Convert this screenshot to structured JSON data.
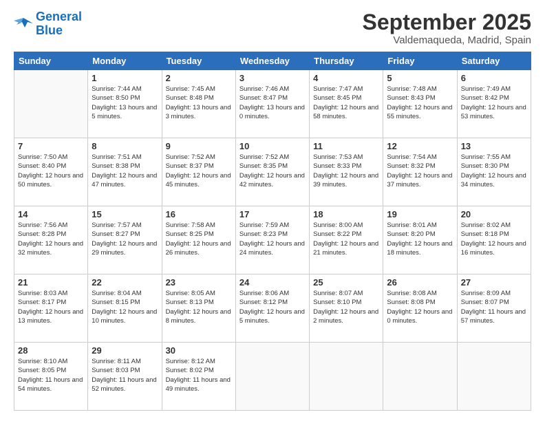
{
  "logo": {
    "line1": "General",
    "line2": "Blue"
  },
  "title": "September 2025",
  "location": "Valdemaqueda, Madrid, Spain",
  "weekdays": [
    "Sunday",
    "Monday",
    "Tuesday",
    "Wednesday",
    "Thursday",
    "Friday",
    "Saturday"
  ],
  "weeks": [
    [
      null,
      {
        "day": 1,
        "sunrise": "7:44 AM",
        "sunset": "8:50 PM",
        "daylight": "13 hours and 5 minutes."
      },
      {
        "day": 2,
        "sunrise": "7:45 AM",
        "sunset": "8:48 PM",
        "daylight": "13 hours and 3 minutes."
      },
      {
        "day": 3,
        "sunrise": "7:46 AM",
        "sunset": "8:47 PM",
        "daylight": "13 hours and 0 minutes."
      },
      {
        "day": 4,
        "sunrise": "7:47 AM",
        "sunset": "8:45 PM",
        "daylight": "12 hours and 58 minutes."
      },
      {
        "day": 5,
        "sunrise": "7:48 AM",
        "sunset": "8:43 PM",
        "daylight": "12 hours and 55 minutes."
      },
      {
        "day": 6,
        "sunrise": "7:49 AM",
        "sunset": "8:42 PM",
        "daylight": "12 hours and 53 minutes."
      }
    ],
    [
      {
        "day": 7,
        "sunrise": "7:50 AM",
        "sunset": "8:40 PM",
        "daylight": "12 hours and 50 minutes."
      },
      {
        "day": 8,
        "sunrise": "7:51 AM",
        "sunset": "8:38 PM",
        "daylight": "12 hours and 47 minutes."
      },
      {
        "day": 9,
        "sunrise": "7:52 AM",
        "sunset": "8:37 PM",
        "daylight": "12 hours and 45 minutes."
      },
      {
        "day": 10,
        "sunrise": "7:52 AM",
        "sunset": "8:35 PM",
        "daylight": "12 hours and 42 minutes."
      },
      {
        "day": 11,
        "sunrise": "7:53 AM",
        "sunset": "8:33 PM",
        "daylight": "12 hours and 39 minutes."
      },
      {
        "day": 12,
        "sunrise": "7:54 AM",
        "sunset": "8:32 PM",
        "daylight": "12 hours and 37 minutes."
      },
      {
        "day": 13,
        "sunrise": "7:55 AM",
        "sunset": "8:30 PM",
        "daylight": "12 hours and 34 minutes."
      }
    ],
    [
      {
        "day": 14,
        "sunrise": "7:56 AM",
        "sunset": "8:28 PM",
        "daylight": "12 hours and 32 minutes."
      },
      {
        "day": 15,
        "sunrise": "7:57 AM",
        "sunset": "8:27 PM",
        "daylight": "12 hours and 29 minutes."
      },
      {
        "day": 16,
        "sunrise": "7:58 AM",
        "sunset": "8:25 PM",
        "daylight": "12 hours and 26 minutes."
      },
      {
        "day": 17,
        "sunrise": "7:59 AM",
        "sunset": "8:23 PM",
        "daylight": "12 hours and 24 minutes."
      },
      {
        "day": 18,
        "sunrise": "8:00 AM",
        "sunset": "8:22 PM",
        "daylight": "12 hours and 21 minutes."
      },
      {
        "day": 19,
        "sunrise": "8:01 AM",
        "sunset": "8:20 PM",
        "daylight": "12 hours and 18 minutes."
      },
      {
        "day": 20,
        "sunrise": "8:02 AM",
        "sunset": "8:18 PM",
        "daylight": "12 hours and 16 minutes."
      }
    ],
    [
      {
        "day": 21,
        "sunrise": "8:03 AM",
        "sunset": "8:17 PM",
        "daylight": "12 hours and 13 minutes."
      },
      {
        "day": 22,
        "sunrise": "8:04 AM",
        "sunset": "8:15 PM",
        "daylight": "12 hours and 10 minutes."
      },
      {
        "day": 23,
        "sunrise": "8:05 AM",
        "sunset": "8:13 PM",
        "daylight": "12 hours and 8 minutes."
      },
      {
        "day": 24,
        "sunrise": "8:06 AM",
        "sunset": "8:12 PM",
        "daylight": "12 hours and 5 minutes."
      },
      {
        "day": 25,
        "sunrise": "8:07 AM",
        "sunset": "8:10 PM",
        "daylight": "12 hours and 2 minutes."
      },
      {
        "day": 26,
        "sunrise": "8:08 AM",
        "sunset": "8:08 PM",
        "daylight": "12 hours and 0 minutes."
      },
      {
        "day": 27,
        "sunrise": "8:09 AM",
        "sunset": "8:07 PM",
        "daylight": "11 hours and 57 minutes."
      }
    ],
    [
      {
        "day": 28,
        "sunrise": "8:10 AM",
        "sunset": "8:05 PM",
        "daylight": "11 hours and 54 minutes."
      },
      {
        "day": 29,
        "sunrise": "8:11 AM",
        "sunset": "8:03 PM",
        "daylight": "11 hours and 52 minutes."
      },
      {
        "day": 30,
        "sunrise": "8:12 AM",
        "sunset": "8:02 PM",
        "daylight": "11 hours and 49 minutes."
      },
      null,
      null,
      null,
      null
    ]
  ]
}
